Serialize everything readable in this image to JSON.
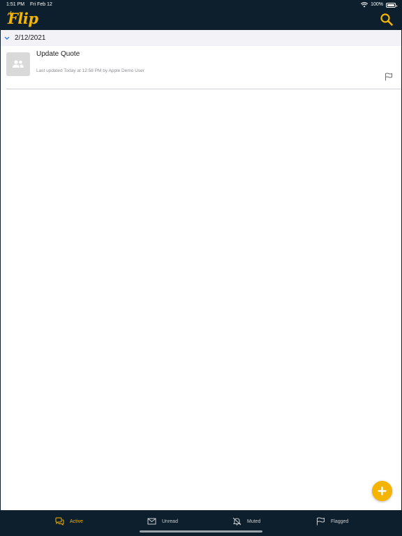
{
  "status_bar": {
    "time": "1:51 PM",
    "date": "Fri Feb 12",
    "battery": "100%",
    "battery_level": 1.0
  },
  "header": {
    "logo_text": "Flip",
    "search_icon": "search-icon"
  },
  "colors": {
    "accent": "#f4b400",
    "nav_background": "#0d1f2d",
    "section_background": "#f2f2f7"
  },
  "conversations": {
    "group_date": "2/12/2021",
    "items": [
      {
        "title": "Update Quote",
        "subtitle": "Last updated Today at 12:58 PM by Apple Demo User",
        "avatar_icon": "group-icon",
        "flag_icon": "flag-icon"
      }
    ]
  },
  "fab": {
    "icon": "plus-icon"
  },
  "tabs": [
    {
      "label": "Active",
      "icon": "chat-bubbles-icon",
      "active": true
    },
    {
      "label": "Unread",
      "icon": "envelope-icon",
      "active": false
    },
    {
      "label": "Muted",
      "icon": "bell-off-icon",
      "active": false
    },
    {
      "label": "Flagged",
      "icon": "flag-icon",
      "active": false
    }
  ]
}
